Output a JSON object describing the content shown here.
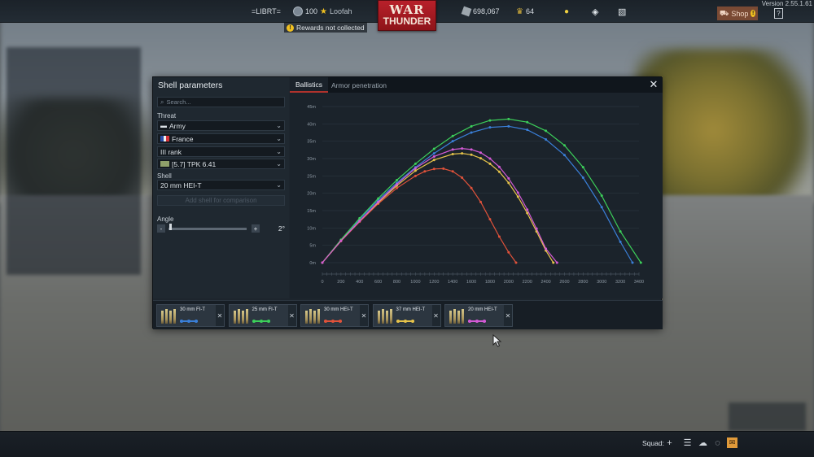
{
  "topbar": {
    "clan_tag": "=LIBRT=",
    "player_level": "100",
    "player_name": "Loofah",
    "silver_lions": "698,067",
    "golden_eagles": "64",
    "shop_label": "Shop",
    "version": "Version 2.55.1.61",
    "rewards_text": "Rewards not collected",
    "logo_line1": "WAR",
    "logo_line2": "THUNDER"
  },
  "dialog": {
    "title": "Shell parameters",
    "search_placeholder": "Search...",
    "threat_label": "Threat",
    "threat_type": "Army",
    "country": "France",
    "rank": "III rank",
    "vehicle": "[5.7] TPK 6.41",
    "shell_label": "Shell",
    "shell": "20 mm HEI-T",
    "add_shell": "Add shell for comparison",
    "angle_label": "Angle",
    "angle_minus": "-",
    "angle_plus": "+",
    "angle_value": "2°",
    "angle_level": 0.02,
    "tabs": [
      "Ballistics",
      "Armor penetration"
    ],
    "active_tab": "Ballistics"
  },
  "comparison": [
    {
      "name": "30 mm FI-T",
      "color": "#3a7fd8"
    },
    {
      "name": "25 mm FI-T",
      "color": "#3ccf5a"
    },
    {
      "name": "30 mm HEI-T",
      "color": "#e0523a"
    },
    {
      "name": "37 mm HEI-T",
      "color": "#e6c34a"
    },
    {
      "name": "20 mm HEI-T",
      "color": "#d35ad6"
    }
  ],
  "chart_data": {
    "type": "line",
    "x_ticks": [
      "0",
      "200",
      "400",
      "600",
      "800",
      "1000",
      "1200",
      "1400",
      "1600",
      "1800",
      "2000",
      "2200",
      "2400",
      "2600",
      "2800",
      "3000",
      "3200",
      "3400"
    ],
    "y_ticks": [
      "0m",
      "5m",
      "10m",
      "15m",
      "20m",
      "25m",
      "30m",
      "35m",
      "40m",
      "45m"
    ],
    "xlim": [
      0,
      3400
    ],
    "ylim": [
      0,
      45
    ],
    "grid": true,
    "series": [
      {
        "color": "#3a7fd8",
        "x": [
          0,
          200,
          400,
          600,
          800,
          1000,
          1200,
          1400,
          1600,
          1800,
          2000,
          2200,
          2400,
          2600,
          2800,
          3000,
          3200,
          3330
        ],
        "y": [
          0,
          6.5,
          12.5,
          18,
          23,
          27.5,
          31.5,
          35,
          37.5,
          39,
          39.3,
          38.3,
          35.5,
          31,
          24.5,
          16,
          6,
          0
        ]
      },
      {
        "color": "#3ccf5a",
        "x": [
          0,
          200,
          400,
          600,
          800,
          1000,
          1200,
          1400,
          1600,
          1800,
          2000,
          2200,
          2400,
          2600,
          2800,
          3000,
          3200,
          3420
        ],
        "y": [
          0,
          6.6,
          12.8,
          18.5,
          23.8,
          28.5,
          32.8,
          36.5,
          39.3,
          41,
          41.4,
          40.5,
          38,
          33.8,
          27.5,
          19.3,
          9,
          0
        ]
      },
      {
        "color": "#e0523a",
        "x": [
          0,
          200,
          400,
          600,
          800,
          1000,
          1100,
          1200,
          1300,
          1400,
          1500,
          1600,
          1700,
          1800,
          1900,
          2000,
          2080
        ],
        "y": [
          0,
          6.2,
          11.8,
          17,
          21.5,
          25,
          26.3,
          27,
          27.1,
          26.3,
          24.5,
          21.5,
          17.5,
          12.5,
          7.5,
          3,
          0
        ]
      },
      {
        "color": "#e6c34a",
        "x": [
          0,
          200,
          400,
          600,
          800,
          1000,
          1200,
          1400,
          1500,
          1600,
          1700,
          1800,
          1900,
          2000,
          2100,
          2200,
          2300,
          2400,
          2480
        ],
        "y": [
          0,
          6.3,
          12,
          17.3,
          22.2,
          26.5,
          29.6,
          31.3,
          31.5,
          31.1,
          30.1,
          28.5,
          26.2,
          23,
          19,
          14.3,
          9,
          3.5,
          0
        ]
      },
      {
        "color": "#d35ad6",
        "x": [
          0,
          200,
          400,
          600,
          800,
          1000,
          1200,
          1400,
          1500,
          1600,
          1700,
          1800,
          1900,
          2000,
          2100,
          2200,
          2300,
          2400,
          2520
        ],
        "y": [
          0,
          6.3,
          12,
          17.5,
          22.6,
          27.2,
          30.6,
          32.6,
          32.9,
          32.6,
          31.7,
          30,
          27.6,
          24.3,
          20.2,
          15.3,
          9.8,
          4,
          0
        ]
      }
    ]
  }
}
